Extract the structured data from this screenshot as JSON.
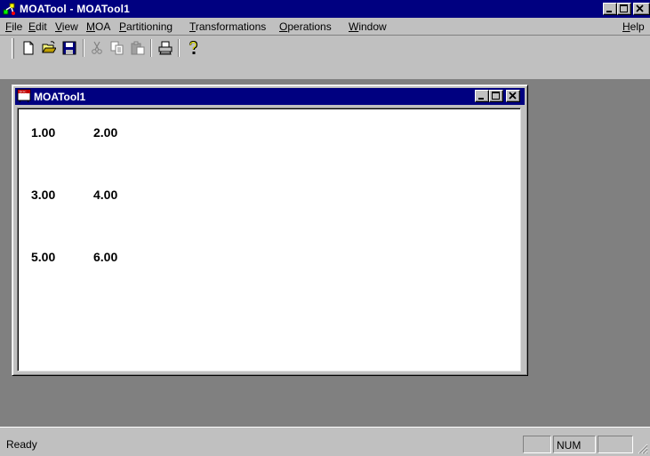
{
  "app": {
    "title": "MOATool - MOATool1",
    "icon": "app-icon"
  },
  "menu": {
    "items": [
      {
        "label": "File",
        "mnemonic": "F"
      },
      {
        "label": "Edit",
        "mnemonic": "E"
      },
      {
        "label": "View",
        "mnemonic": "V"
      },
      {
        "label": "MOA",
        "mnemonic": "M"
      },
      {
        "label": "Partitioning",
        "mnemonic": "P"
      },
      {
        "label": "Transformations",
        "mnemonic": "T"
      },
      {
        "label": "Operations",
        "mnemonic": "O"
      },
      {
        "label": "Window",
        "mnemonic": "W"
      }
    ],
    "help": {
      "label": "Help",
      "mnemonic": "H"
    }
  },
  "toolbar": {
    "buttons": [
      "new-icon",
      "open-icon",
      "save-icon",
      "cut-icon",
      "copy-icon",
      "paste-icon",
      "print-icon",
      "help-icon"
    ]
  },
  "document": {
    "title": "MOATool1",
    "icon": "document-icon",
    "cells": [
      [
        "1.00",
        "2.00"
      ],
      [
        "3.00",
        "4.00"
      ],
      [
        "5.00",
        "6.00"
      ]
    ]
  },
  "status": {
    "text": "Ready",
    "indicators": [
      "",
      "NUM",
      ""
    ]
  },
  "colors": {
    "titlebar": "#000080",
    "face": "#c0c0c0",
    "workspace": "#808080"
  }
}
